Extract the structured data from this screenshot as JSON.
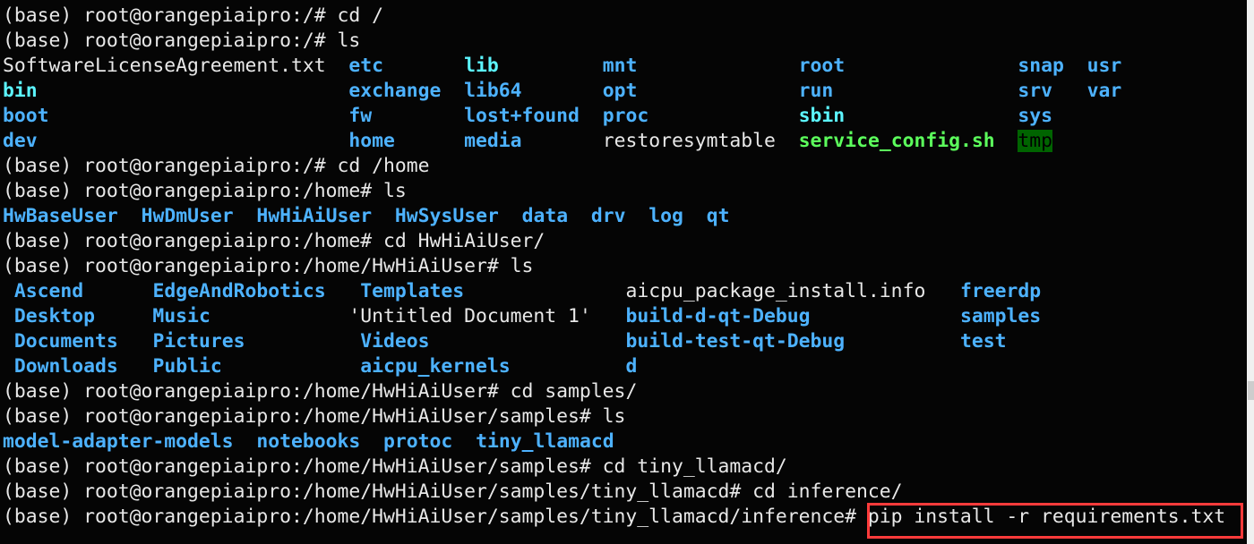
{
  "terminal": {
    "lines": [
      {
        "type": "cmd",
        "prompt": "(base) root@orangepiaipro:/# ",
        "command": "cd /"
      },
      {
        "type": "cmd",
        "prompt": "(base) root@orangepiaipro:/# ",
        "command": "ls"
      },
      {
        "type": "ls",
        "rows": [
          [
            {
              "t": "SoftwareLicenseAgreement.txt",
              "k": "file"
            },
            {
              "t": "etc",
              "k": "dir"
            },
            {
              "t": "lib",
              "k": "link"
            },
            {
              "t": "mnt",
              "k": "dir"
            },
            {
              "t": "root",
              "k": "dir"
            },
            {
              "t": "snap",
              "k": "dir"
            },
            {
              "t": "usr",
              "k": "dir"
            }
          ],
          [
            {
              "t": "bin",
              "k": "link"
            },
            {
              "t": "exchange",
              "k": "dir"
            },
            {
              "t": "lib64",
              "k": "dir"
            },
            {
              "t": "opt",
              "k": "dir"
            },
            {
              "t": "run",
              "k": "dir"
            },
            {
              "t": "srv",
              "k": "dir"
            },
            {
              "t": "var",
              "k": "dir"
            }
          ],
          [
            {
              "t": "boot",
              "k": "dir"
            },
            {
              "t": "fw",
              "k": "dir"
            },
            {
              "t": "lost+found",
              "k": "dir"
            },
            {
              "t": "proc",
              "k": "dir"
            },
            {
              "t": "sbin",
              "k": "link"
            },
            {
              "t": "sys",
              "k": "dir"
            }
          ],
          [
            {
              "t": "dev",
              "k": "dir"
            },
            {
              "t": "home",
              "k": "dir"
            },
            {
              "t": "media",
              "k": "dir"
            },
            {
              "t": "restoresymtable",
              "k": "file"
            },
            {
              "t": "service_config.sh",
              "k": "exec"
            },
            {
              "t": "tmp",
              "k": "sticky"
            }
          ]
        ]
      },
      {
        "type": "cmd",
        "prompt": "(base) root@orangepiaipro:/# ",
        "command": "cd /home"
      },
      {
        "type": "cmd",
        "prompt": "(base) root@orangepiaipro:/home# ",
        "command": "ls"
      },
      {
        "type": "ls",
        "sep": 2,
        "rows": [
          [
            {
              "t": "HwBaseUser",
              "k": "dir"
            },
            {
              "t": "HwDmUser",
              "k": "dir"
            },
            {
              "t": "HwHiAiUser",
              "k": "dir"
            },
            {
              "t": "HwSysUser",
              "k": "dir"
            },
            {
              "t": "data",
              "k": "dir"
            },
            {
              "t": "drv",
              "k": "dir"
            },
            {
              "t": "log",
              "k": "dir"
            },
            {
              "t": "qt",
              "k": "dir"
            }
          ]
        ]
      },
      {
        "type": "cmd",
        "prompt": "(base) root@orangepiaipro:/home# ",
        "command": "cd HwHiAiUser/"
      },
      {
        "type": "cmd",
        "prompt": "(base) root@orangepiaipro:/home/HwHiAiUser# ",
        "command": "ls"
      },
      {
        "type": "ls",
        "rows": [
          [
            {
              "t": " Ascend",
              "k": "dir"
            },
            {
              "t": " EdgeAndRobotics",
              "k": "dir"
            },
            {
              "t": " Templates",
              "k": "dir"
            },
            {
              "t": " aicpu_package_install.info",
              "k": "file"
            },
            {
              "t": " freerdp",
              "k": "dir"
            }
          ],
          [
            {
              "t": " Desktop",
              "k": "dir"
            },
            {
              "t": " Music",
              "k": "dir"
            },
            {
              "t": "'Untitled Document 1'",
              "k": "file"
            },
            {
              "t": " build-d-qt-Debug",
              "k": "dir"
            },
            {
              "t": " samples",
              "k": "dir"
            }
          ],
          [
            {
              "t": " Documents",
              "k": "dir"
            },
            {
              "t": " Pictures",
              "k": "dir"
            },
            {
              "t": " Videos",
              "k": "dir"
            },
            {
              "t": " build-test-qt-Debug",
              "k": "dir"
            },
            {
              "t": " test",
              "k": "dir"
            }
          ],
          [
            {
              "t": " Downloads",
              "k": "dir"
            },
            {
              "t": " Public",
              "k": "dir"
            },
            {
              "t": " aicpu_kernels",
              "k": "dir"
            },
            {
              "t": " d",
              "k": "dir"
            }
          ]
        ]
      },
      {
        "type": "cmd",
        "prompt": "(base) root@orangepiaipro:/home/HwHiAiUser# ",
        "command": "cd samples/"
      },
      {
        "type": "cmd",
        "prompt": "(base) root@orangepiaipro:/home/HwHiAiUser/samples# ",
        "command": "ls"
      },
      {
        "type": "ls",
        "sep": 2,
        "rows": [
          [
            {
              "t": "model-adapter-models",
              "k": "dir"
            },
            {
              "t": "notebooks",
              "k": "dir"
            },
            {
              "t": "protoc",
              "k": "dir"
            },
            {
              "t": "tiny_llamacd",
              "k": "dir"
            }
          ]
        ]
      },
      {
        "type": "cmd",
        "prompt": "(base) root@orangepiaipro:/home/HwHiAiUser/samples# ",
        "command": "cd tiny_llamacd/"
      },
      {
        "type": "cmd",
        "prompt": "(base) root@orangepiaipro:/home/HwHiAiUser/samples/tiny_llamacd# ",
        "command": "cd inference/"
      },
      {
        "type": "cmd",
        "prompt": "(base) root@orangepiaipro:/home/HwHiAiUser/samples/tiny_llamacd/inference# ",
        "command": "pip install -r requirements.txt",
        "highlighted": true
      }
    ]
  },
  "colors": {
    "background": "#050505",
    "directory": "#4db2ff",
    "symlink": "#5cf5ff",
    "executable": "#5cff5c",
    "sticky_bg": "#006400",
    "highlight_box": "#ff3b3b"
  }
}
